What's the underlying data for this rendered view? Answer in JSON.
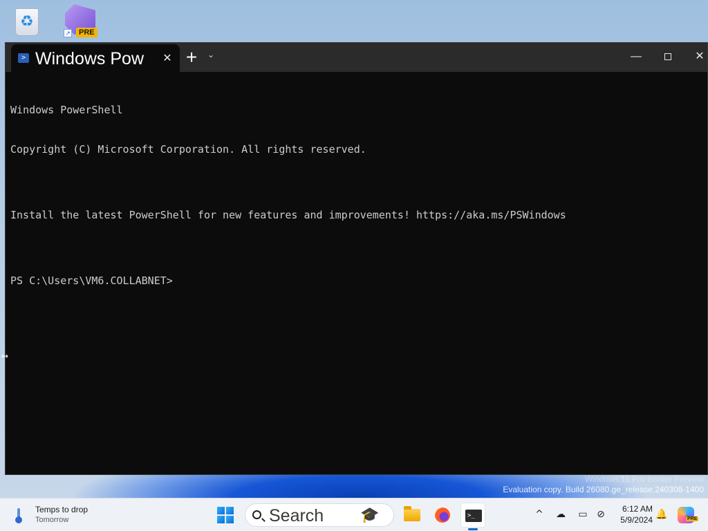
{
  "desktop": {
    "icons": [
      {
        "name": "recycle-bin",
        "icon": "recycle-bin-icon"
      },
      {
        "name": "visual-studio-preview",
        "icon": "visual-studio-icon",
        "badge": "PRE"
      }
    ]
  },
  "terminal": {
    "tab_title": "Windows Pow",
    "tab_close": "✕",
    "new_tab": "+",
    "dropdown": "⌄",
    "controls": {
      "minimize": "—",
      "maximize": "",
      "close": "✕"
    },
    "lines": [
      "Windows PowerShell",
      "Copyright (C) Microsoft Corporation. All rights reserved.",
      "",
      "Install the latest PowerShell for new features and improvements! https://aka.ms/PSWindows",
      "",
      "PS C:\\Users\\VM6.COLLABNET>"
    ],
    "colors": {
      "background": "#0c0c0c",
      "titlebar": "#2b2b2b",
      "text": "#cccccc"
    }
  },
  "watermark": {
    "line1": "Windows 11 Pro Insider Preview",
    "line2": "Evaluation copy. Build 26080.ge_release.240308-1400"
  },
  "taskbar": {
    "weather": {
      "title": "Temps to drop",
      "subtitle": "Tomorrow",
      "icon": "thermometer-icon"
    },
    "search": {
      "placeholder": "Search"
    },
    "apps": [
      {
        "name": "File Explorer",
        "icon": "folder-icon"
      },
      {
        "name": "Firefox",
        "icon": "firefox-icon"
      },
      {
        "name": "Terminal",
        "icon": "terminal-icon",
        "active": true
      }
    ],
    "tray": {
      "chevron": "^",
      "time": "6:12 AM",
      "date": "5/9/2024",
      "copilot_badge": "PRE"
    }
  }
}
